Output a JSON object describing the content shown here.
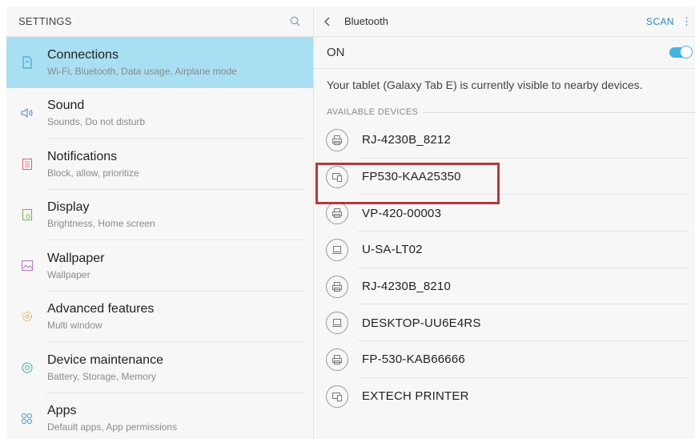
{
  "left": {
    "title": "SETTINGS",
    "search_icon": "search-icon",
    "items": [
      {
        "title": "Connections",
        "subtitle": "Wi-Fi, Bluetooth, Data usage, Airplane mode",
        "icon": "connections-icon",
        "active": true
      },
      {
        "title": "Sound",
        "subtitle": "Sounds, Do not disturb",
        "icon": "sound-icon"
      },
      {
        "title": "Notifications",
        "subtitle": "Block, allow, prioritize",
        "icon": "notifications-icon"
      },
      {
        "title": "Display",
        "subtitle": "Brightness, Home screen",
        "icon": "display-icon"
      },
      {
        "title": "Wallpaper",
        "subtitle": "Wallpaper",
        "icon": "wallpaper-icon"
      },
      {
        "title": "Advanced features",
        "subtitle": "Multi window",
        "icon": "advanced-features-icon"
      },
      {
        "title": "Device maintenance",
        "subtitle": "Battery, Storage, Memory",
        "icon": "device-maintenance-icon"
      },
      {
        "title": "Apps",
        "subtitle": "Default apps, App permissions",
        "icon": "apps-icon"
      }
    ]
  },
  "right": {
    "title": "Bluetooth",
    "scan_label": "SCAN",
    "toggle_label": "ON",
    "toggle_on": true,
    "visibility_text": "Your tablet (Galaxy Tab E) is currently visible to nearby devices.",
    "section_label": "AVAILABLE DEVICES",
    "devices": [
      {
        "name": "RJ-4230B_8212",
        "icon": "printer-icon"
      },
      {
        "name": "FP530-KAA25350",
        "icon": "device-icon"
      },
      {
        "name": "VP-420-00003",
        "icon": "printer-icon"
      },
      {
        "name": "U-SA-LT02",
        "icon": "laptop-icon"
      },
      {
        "name": "RJ-4230B_8210",
        "icon": "printer-icon"
      },
      {
        "name": "DESKTOP-UU6E4RS",
        "icon": "laptop-icon"
      },
      {
        "name": "FP-530-KAB66666",
        "icon": "printer-icon"
      },
      {
        "name": "EXTECH PRINTER",
        "icon": "device-icon"
      }
    ]
  },
  "colors": {
    "accent": "#2b84c2",
    "active_item_bg": "#a9dff3",
    "switch_on": "#45b2e3",
    "highlight_border": "#b5393b"
  }
}
